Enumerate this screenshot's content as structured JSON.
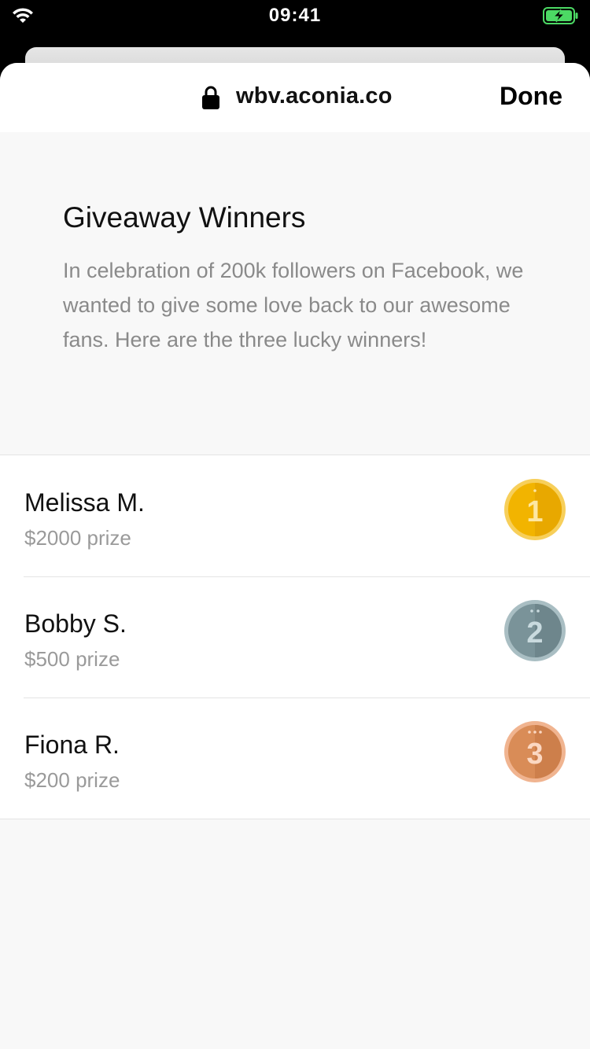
{
  "status_bar": {
    "time": "09:41",
    "wifi_icon": "wifi-icon",
    "battery_icon": "battery-charging-icon",
    "battery_color": "#4cd964"
  },
  "browser": {
    "url": "wbv.aconia.co",
    "lock_icon": "lock-icon",
    "done_label": "Done"
  },
  "page": {
    "title": "Giveaway Winners",
    "description": "In celebration of 200k followers on Facebook, we wanted to give some love back to our awesome fans. Here are the three lucky winners!"
  },
  "winners": [
    {
      "name": "Melissa M.",
      "prize": "$2000 prize",
      "medal_icon": "gold-medal-icon",
      "rank": "1",
      "medal_color": "#f2b400"
    },
    {
      "name": "Bobby S.",
      "prize": "$500 prize",
      "medal_icon": "silver-medal-icon",
      "rank": "2",
      "medal_color": "#7a9399"
    },
    {
      "name": "Fiona R.",
      "prize": "$200 prize",
      "medal_icon": "bronze-medal-icon",
      "rank": "3",
      "medal_color": "#d98c57"
    }
  ]
}
